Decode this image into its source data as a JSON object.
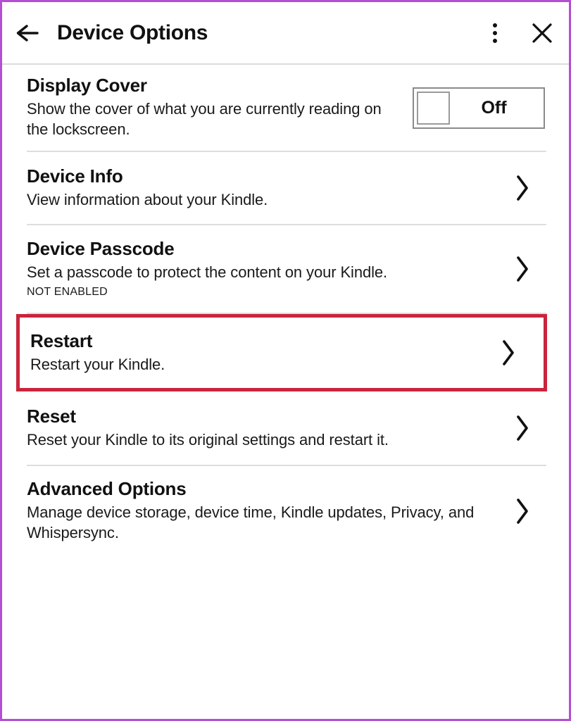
{
  "header": {
    "title": "Device Options",
    "back_icon": "arrow-left-icon",
    "menu_icon": "overflow-menu-icon",
    "close_icon": "close-icon"
  },
  "theme": {
    "border": "#b44fd4",
    "highlight": "#c9253c",
    "text": "#111111",
    "divider": "#dedede"
  },
  "settings": [
    {
      "title": "Display Cover",
      "description": "Show the cover of what you are currently reading on the lockscreen.",
      "control": "toggle",
      "toggle_value": "Off"
    },
    {
      "title": "Device Info",
      "description": "View information about your Kindle.",
      "control": "chevron"
    },
    {
      "title": "Device Passcode",
      "description": "Set a passcode to protect the content on your Kindle.",
      "status": "NOT ENABLED",
      "control": "chevron"
    },
    {
      "title": "Restart",
      "description": "Restart your Kindle.",
      "control": "chevron",
      "highlighted": true
    },
    {
      "title": "Reset",
      "description": "Reset your Kindle to its original settings and restart it.",
      "control": "chevron"
    },
    {
      "title": "Advanced Options",
      "description": "Manage device storage, device time, Kindle updates, Privacy, and Whispersync.",
      "control": "chevron"
    }
  ]
}
